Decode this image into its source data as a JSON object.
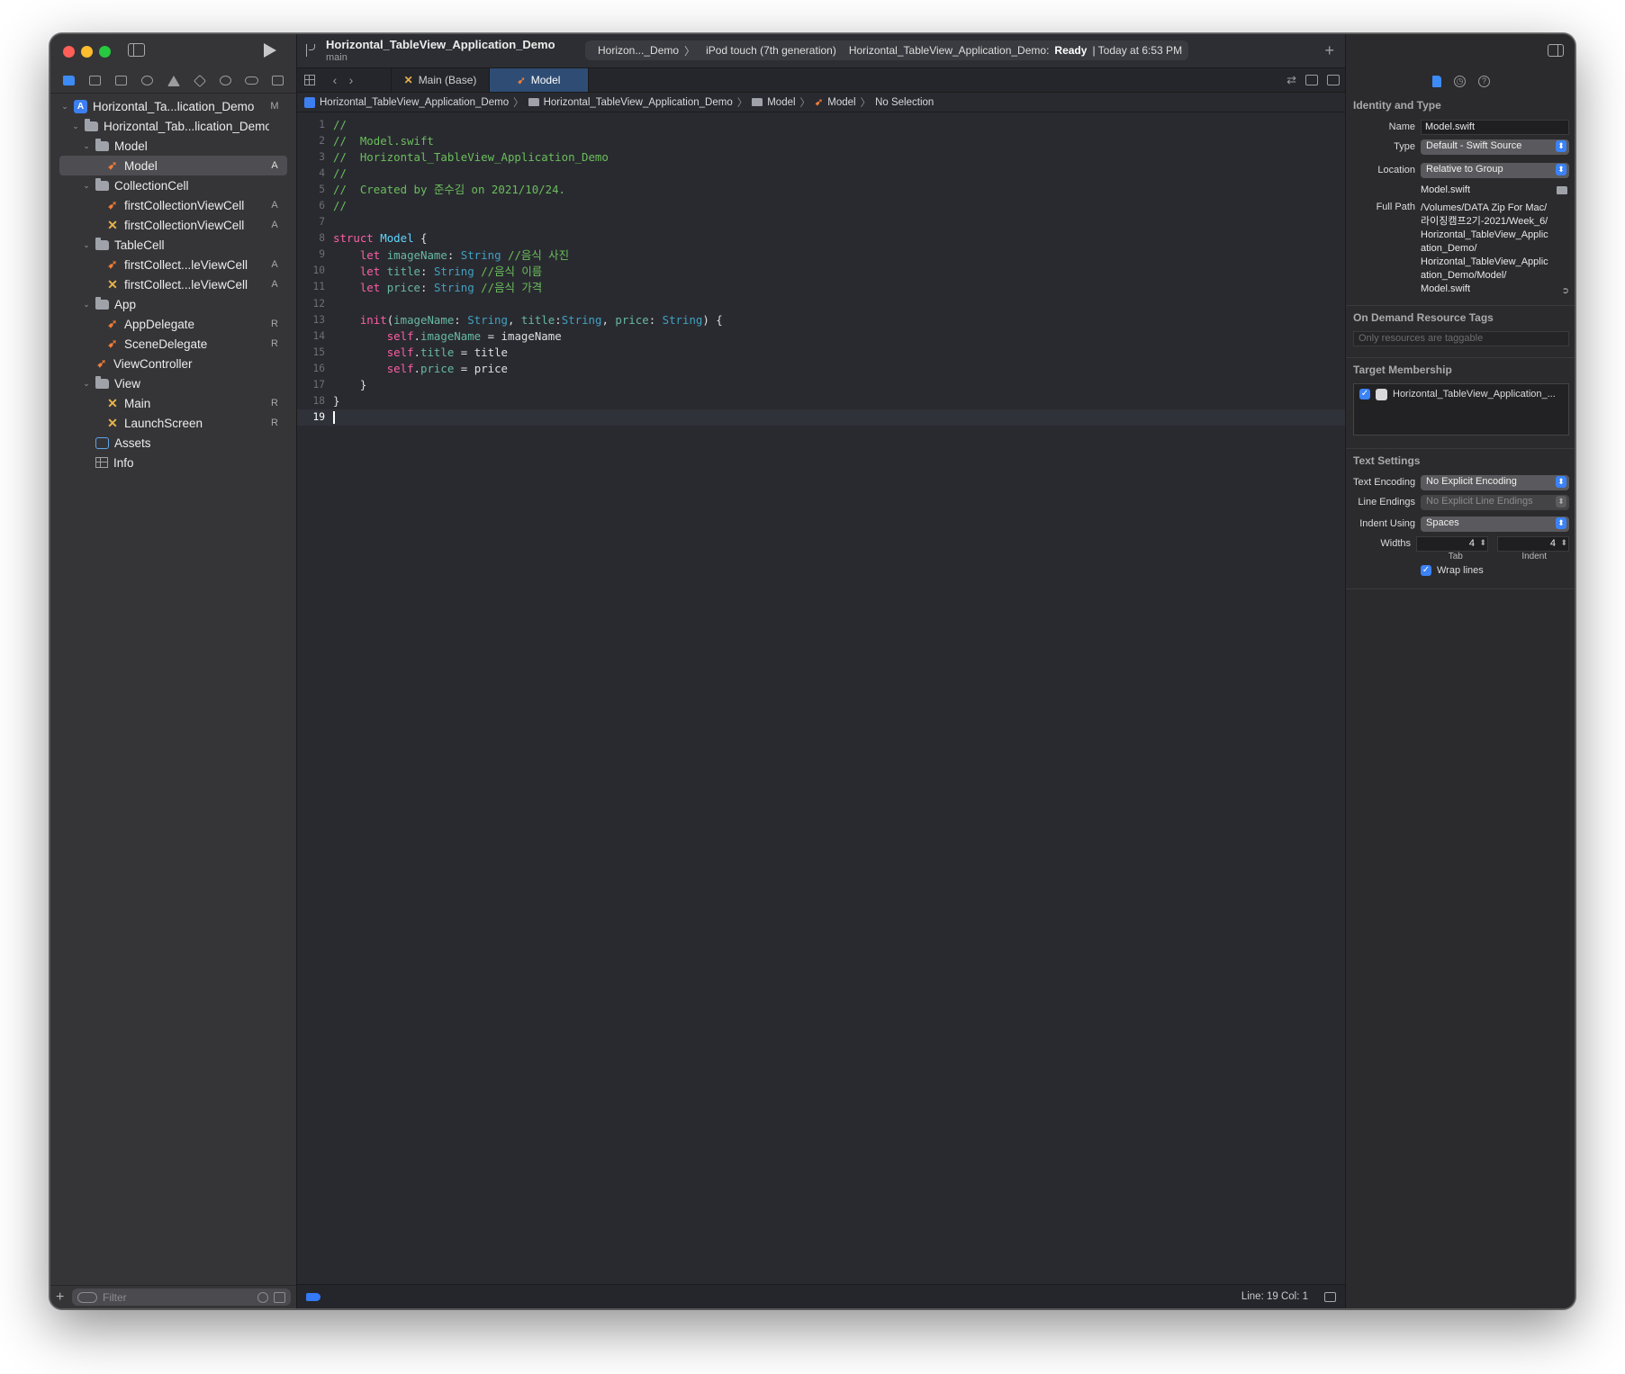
{
  "navigator": {
    "filter_placeholder": "Filter",
    "tree": [
      {
        "label": "Horizontal_Ta...lication_Demo",
        "badge": "M",
        "kind": "project",
        "level": 0,
        "expanded": true
      },
      {
        "label": "Horizontal_Tab...lication_Demo",
        "badge": "",
        "kind": "folder",
        "level": 1,
        "expanded": true
      },
      {
        "label": "Model",
        "badge": "",
        "kind": "folder",
        "level": 2,
        "expanded": true
      },
      {
        "label": "Model",
        "badge": "A",
        "kind": "swift",
        "level": 3,
        "selected": true
      },
      {
        "label": "CollectionCell",
        "badge": "",
        "kind": "folder",
        "level": 2,
        "expanded": true
      },
      {
        "label": "firstCollectionViewCell",
        "badge": "A",
        "kind": "swift",
        "level": 3
      },
      {
        "label": "firstCollectionViewCell",
        "badge": "A",
        "kind": "xib",
        "level": 3
      },
      {
        "label": "TableCell",
        "badge": "",
        "kind": "folder",
        "level": 2,
        "expanded": true
      },
      {
        "label": "firstCollect...leViewCell",
        "badge": "A",
        "kind": "swift",
        "level": 3
      },
      {
        "label": "firstCollect...leViewCell",
        "badge": "A",
        "kind": "xib",
        "level": 3
      },
      {
        "label": "App",
        "badge": "",
        "kind": "folder",
        "level": 2,
        "expanded": true
      },
      {
        "label": "AppDelegate",
        "badge": "R",
        "kind": "swift",
        "level": 3
      },
      {
        "label": "SceneDelegate",
        "badge": "R",
        "kind": "swift",
        "level": 3
      },
      {
        "label": "ViewController",
        "badge": "",
        "kind": "swift",
        "level": 2
      },
      {
        "label": "View",
        "badge": "",
        "kind": "folder",
        "level": 2,
        "expanded": true
      },
      {
        "label": "Main",
        "badge": "R",
        "kind": "xib",
        "level": 3
      },
      {
        "label": "LaunchScreen",
        "badge": "R",
        "kind": "xib",
        "level": 3
      },
      {
        "label": "Assets",
        "badge": "",
        "kind": "assets",
        "level": 2
      },
      {
        "label": "Info",
        "badge": "",
        "kind": "plist",
        "level": 2
      }
    ]
  },
  "toolbar": {
    "project_name": "Horizontal_TableView_Application_Demo",
    "branch": "main",
    "scheme": "Horizon..._Demo",
    "device": "iPod touch (7th generation)",
    "status_prefix": "Horizontal_TableView_Application_Demo:",
    "status_state": "Ready",
    "status_time": "| Today at 6:53 PM"
  },
  "tabs": [
    {
      "label": "Main (Base)",
      "kind": "xib",
      "active": false
    },
    {
      "label": "Model",
      "kind": "swift",
      "active": true
    }
  ],
  "jumpbar": {
    "project": "Horizontal_TableView_Application_Demo",
    "group": "Horizontal_TableView_Application_Demo",
    "folder": "Model",
    "file": "Model",
    "symbol": "No Selection"
  },
  "code": {
    "current_line": 19,
    "lines": [
      [
        [
          "c",
          "//"
        ]
      ],
      [
        [
          "c",
          "//  Model.swift"
        ]
      ],
      [
        [
          "c",
          "//  Horizontal_TableView_Application_Demo"
        ]
      ],
      [
        [
          "c",
          "//"
        ]
      ],
      [
        [
          "c",
          "//  Created by 준수김 on 2021/10/24."
        ]
      ],
      [
        [
          "c",
          "//"
        ]
      ],
      [],
      [
        [
          "k",
          "struct"
        ],
        [
          "p",
          " "
        ],
        [
          "t",
          "Model"
        ],
        [
          "p",
          " {"
        ]
      ],
      [
        [
          "p",
          "    "
        ],
        [
          "k",
          "let"
        ],
        [
          "p",
          " "
        ],
        [
          "d",
          "imageName"
        ],
        [
          "p",
          ": "
        ],
        [
          "y",
          "String"
        ],
        [
          "p",
          " "
        ],
        [
          "c",
          "//음식 사진"
        ]
      ],
      [
        [
          "p",
          "    "
        ],
        [
          "k",
          "let"
        ],
        [
          "p",
          " "
        ],
        [
          "d",
          "title"
        ],
        [
          "p",
          ": "
        ],
        [
          "y",
          "String"
        ],
        [
          "p",
          " "
        ],
        [
          "c",
          "//음식 이름"
        ]
      ],
      [
        [
          "p",
          "    "
        ],
        [
          "k",
          "let"
        ],
        [
          "p",
          " "
        ],
        [
          "d",
          "price"
        ],
        [
          "p",
          ": "
        ],
        [
          "y",
          "String"
        ],
        [
          "p",
          " "
        ],
        [
          "c",
          "//음식 가격"
        ]
      ],
      [],
      [
        [
          "p",
          "    "
        ],
        [
          "k",
          "init"
        ],
        [
          "p",
          "("
        ],
        [
          "d",
          "imageName"
        ],
        [
          "p",
          ": "
        ],
        [
          "y",
          "String"
        ],
        [
          "p",
          ", "
        ],
        [
          "d",
          "title"
        ],
        [
          "p",
          ":"
        ],
        [
          "y",
          "String"
        ],
        [
          "p",
          ", "
        ],
        [
          "d",
          "price"
        ],
        [
          "p",
          ": "
        ],
        [
          "y",
          "String"
        ],
        [
          "p",
          ") {"
        ]
      ],
      [
        [
          "p",
          "        "
        ],
        [
          "k",
          "self"
        ],
        [
          "p",
          "."
        ],
        [
          "r",
          "imageName"
        ],
        [
          "p",
          " = imageName"
        ]
      ],
      [
        [
          "p",
          "        "
        ],
        [
          "k",
          "self"
        ],
        [
          "p",
          "."
        ],
        [
          "r",
          "title"
        ],
        [
          "p",
          " = title"
        ]
      ],
      [
        [
          "p",
          "        "
        ],
        [
          "k",
          "self"
        ],
        [
          "p",
          "."
        ],
        [
          "r",
          "price"
        ],
        [
          "p",
          " = price"
        ]
      ],
      [
        [
          "p",
          "    }"
        ]
      ],
      [
        [
          "p",
          "}"
        ]
      ],
      []
    ]
  },
  "statusbar": {
    "position": "Line: 19  Col: 1"
  },
  "inspector": {
    "identity": {
      "title": "Identity and Type",
      "name_label": "Name",
      "name_value": "Model.swift",
      "type_label": "Type",
      "type_value": "Default - Swift Source",
      "location_label": "Location",
      "location_value": "Relative to Group",
      "location_file": "Model.swift",
      "fullpath_label": "Full Path",
      "fullpath_lines": [
        "/Volumes/DATA Zip For Mac/",
        "라이징캠프2기-2021/Week_6/",
        "Horizontal_TableView_Applic",
        "ation_Demo/",
        "Horizontal_TableView_Applic",
        "ation_Demo/Model/",
        "Model.swift"
      ]
    },
    "odr": {
      "title": "On Demand Resource Tags",
      "placeholder": "Only resources are taggable"
    },
    "target": {
      "title": "Target Membership",
      "name": "Horizontal_TableView_Application_...",
      "checked": true
    },
    "text_settings": {
      "title": "Text Settings",
      "encoding_label": "Text Encoding",
      "encoding_value": "No Explicit Encoding",
      "endings_label": "Line Endings",
      "endings_value": "No Explicit Line Endings",
      "indent_label": "Indent Using",
      "indent_value": "Spaces",
      "widths_label": "Widths",
      "tab_width": "4",
      "indent_width": "4",
      "tab_sublabel": "Tab",
      "indent_sublabel": "Indent",
      "wrap_label": "Wrap lines",
      "wrap_checked": true
    }
  },
  "colors": {
    "accent": "#3d8bf7",
    "comment": "#6bbe5b",
    "keyword": "#fc5fa3",
    "type": "#5dd8ff",
    "declaration": "#41a1c0",
    "property": "#67b7a4"
  }
}
